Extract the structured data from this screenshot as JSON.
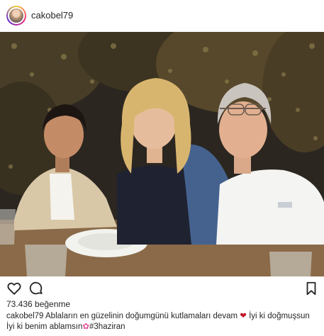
{
  "header": {
    "username": "cakobel79"
  },
  "post": {
    "likes_text": "73.436 beğenme",
    "caption": {
      "user": "cakobel79",
      "text_part1": " Ablaların en güzelinin doğumgünü kutlamaları devam ",
      "heart": "❤",
      "text_part2": " İyi ki doğmuşsun İyi ki benim ablamsın",
      "flower": "✿",
      "hashtag": "#3haziran"
    }
  },
  "colors": {
    "text": "#262626",
    "gradient": [
      "#f9ce34",
      "#ee2a7b",
      "#6228d7"
    ]
  },
  "icons": [
    "heart-icon",
    "comment-icon",
    "bookmark-icon"
  ]
}
